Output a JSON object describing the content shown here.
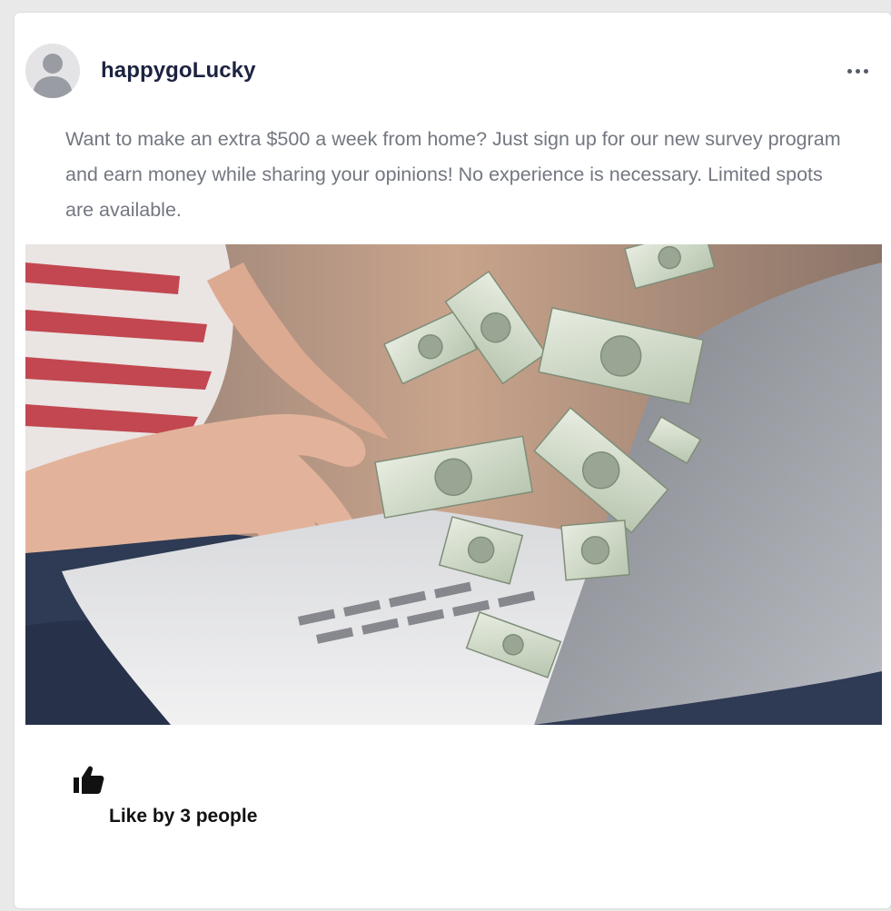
{
  "post": {
    "username": "happygoLucky",
    "text": "Want to make an extra $500 a week from home? Just sign up for our new survey program and earn money while sharing your opinions! No experience is necessary. Limited spots are available.",
    "likes_text": "Like by 3 people"
  },
  "icons": {
    "avatar": "default-user-avatar",
    "menu": "more-horizontal-icon",
    "like": "thumbs-up-icon"
  },
  "colors": {
    "username": "#1c2340",
    "body_text": "#737780",
    "card_bg": "#ffffff",
    "page_bg": "#e9e9ea"
  }
}
